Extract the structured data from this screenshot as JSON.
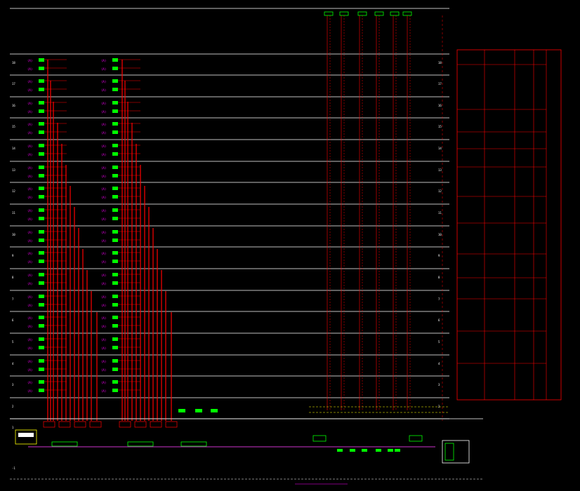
{
  "title": "",
  "floor_labels": [
    "18",
    "17",
    "16",
    "15",
    "14",
    "13",
    "12",
    "11",
    "10",
    "9",
    "8",
    "7",
    "6",
    "5",
    "4",
    "3",
    "2",
    "1",
    "-1"
  ],
  "colors": {
    "background": "#000000",
    "floor_line": "#ffffff",
    "riser": "#ff0000",
    "device": "#00ff00",
    "label": "#ff00ff",
    "dashed": "#ffff00",
    "bus": "#cc33cc"
  },
  "legend_panel": {
    "columns": [
      "",
      "",
      "",
      ""
    ]
  },
  "top_devices": [
    "",
    "",
    "",
    "",
    "",
    ""
  ],
  "controller_label": ""
}
